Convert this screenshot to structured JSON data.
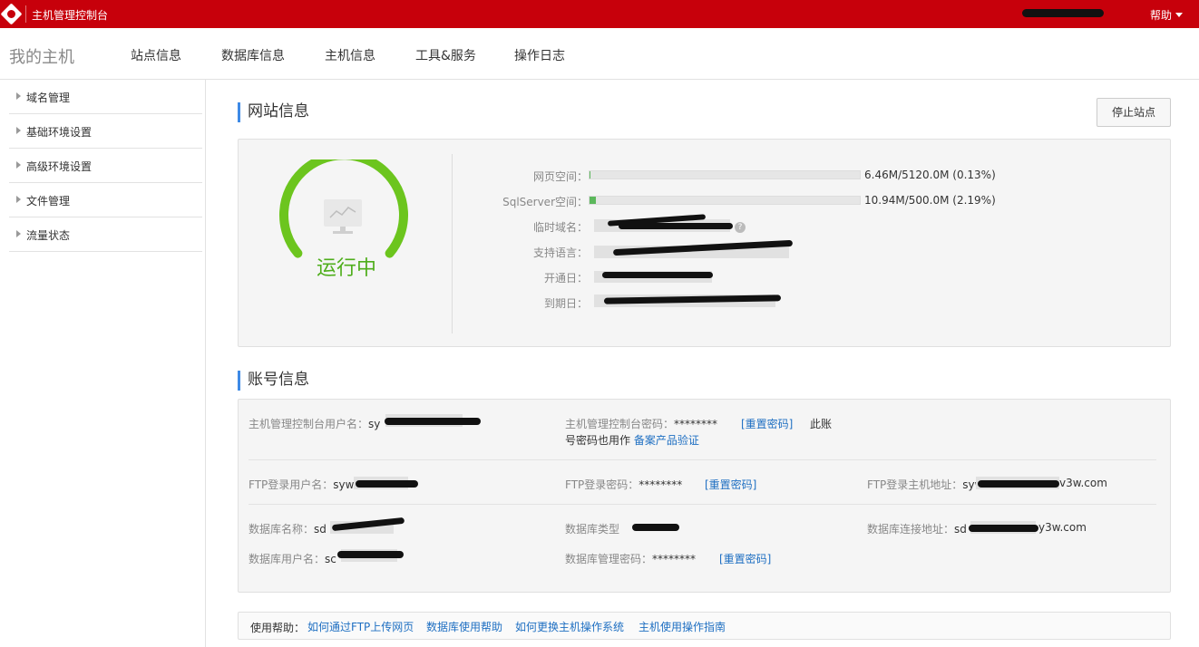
{
  "topbar": {
    "title": "主机管理控制台",
    "help": "帮助"
  },
  "nav": {
    "brand": "我的主机",
    "items": [
      "站点信息",
      "数据库信息",
      "主机信息",
      "工具&服务",
      "操作日志"
    ]
  },
  "sidebar": {
    "items": [
      "域名管理",
      "基础环境设置",
      "高级环境设置",
      "文件管理",
      "流量状态"
    ]
  },
  "site": {
    "heading": "网站信息",
    "stop_button": "停止站点",
    "status": "运行中",
    "status_color": "#4fae1c",
    "labels": {
      "web_space": "网页空间：",
      "sql_space": "SqlServer空间：",
      "temp_domain": "临时域名：",
      "languages": "支持语言：",
      "open_date": "开通日：",
      "expire_date": "到期日："
    },
    "web_space_usage": {
      "text": "6.46M/5120.0M (0.13%)",
      "fraction": 0.0013
    },
    "sql_space_usage": {
      "text": "10.94M/500.0M (2.19%)",
      "fraction": 0.0219
    }
  },
  "account": {
    "heading": "账号信息",
    "console_user_label": "主机管理控制台用户名：",
    "console_user_value": "sy",
    "console_pwd_label": "主机管理控制台密码：",
    "console_pwd_value": "********",
    "reset_label": "[重置密码]",
    "console_note_1": "此账",
    "console_note_2": "号密码也用作",
    "console_note_link": "备案产品验证",
    "ftp_user_label": "FTP登录用户名：",
    "ftp_user_value": "syw",
    "ftp_pwd_label": "FTP登录密码：",
    "ftp_pwd_value": "********",
    "ftp_host_label": "FTP登录主机地址：",
    "ftp_host_prefix": "syw",
    "ftp_host_suffix": "v3w.com",
    "db_name_label": "数据库名称：",
    "db_name_value": "sd",
    "db_type_label": "数据库类型",
    "db_host_label": "数据库连接地址：",
    "db_host_prefix": "sd",
    "db_host_suffix": "y3w.com",
    "db_user_label": "数据库用户名：",
    "db_user_value": "sc",
    "db_pwd_label": "数据库管理密码：",
    "db_pwd_value": "********"
  },
  "help_bar": {
    "label": "使用帮助：",
    "links": [
      "如何通过FTP上传网页",
      "数据库使用帮助",
      "如何更换主机操作系统",
      "主机使用操作指南"
    ]
  }
}
